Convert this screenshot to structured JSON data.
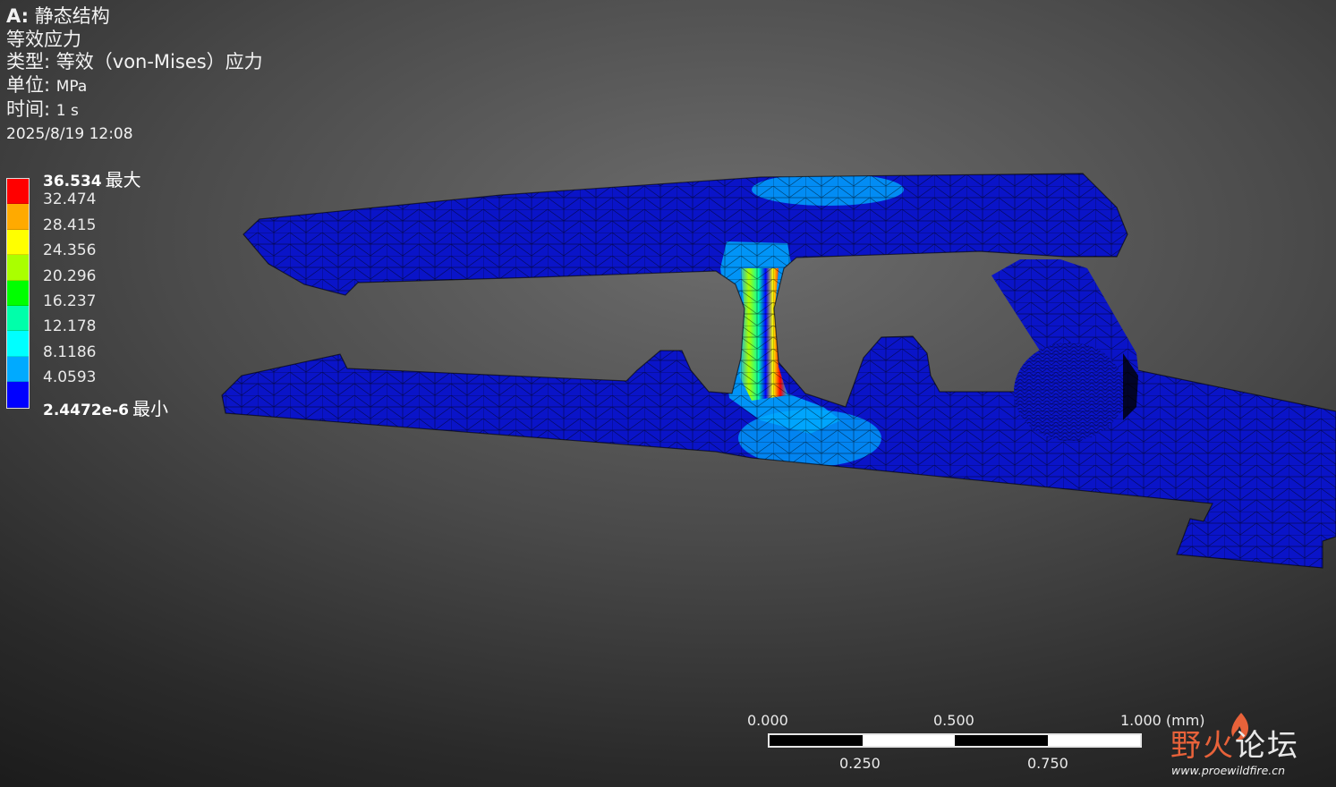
{
  "header": {
    "analysis_prefix": "A:",
    "analysis_name": "静态结构",
    "result_name": "等效应力",
    "type_label": "类型:",
    "type_value": "等效（von-Mises）应力",
    "unit_label": "单位:",
    "unit_value": "MPa",
    "time_label": "时间:",
    "time_value": "1 s",
    "timestamp": "2025/8/19 12:08"
  },
  "legend": {
    "max_value": "36.534",
    "max_tag": "最大",
    "min_value": "2.4472e-6",
    "min_tag": "最小",
    "levels": [
      "36.534",
      "32.474",
      "28.415",
      "24.356",
      "20.296",
      "16.237",
      "12.178",
      "8.1186",
      "4.0593",
      "2.4472e-6"
    ],
    "colors": [
      "#ff0000",
      "#ffaa00",
      "#ffff00",
      "#aaff00",
      "#00ff00",
      "#00ffaa",
      "#00ffff",
      "#00aaff",
      "#0000ff"
    ]
  },
  "scale_bar": {
    "top_labels": [
      "0.000",
      "0.500",
      "1.000 (mm)"
    ],
    "bottom_labels": [
      "0.250",
      "0.750"
    ],
    "segment_colors": [
      "#000000",
      "#ffffff",
      "#000000",
      "#ffffff"
    ]
  },
  "watermark": {
    "text_a": "野火",
    "text_b": "论坛",
    "url": "www.proewildfire.cn",
    "accent": "#e8623a"
  },
  "model": {
    "base_color": "#0a14c8",
    "mesh_color": "#000000"
  }
}
